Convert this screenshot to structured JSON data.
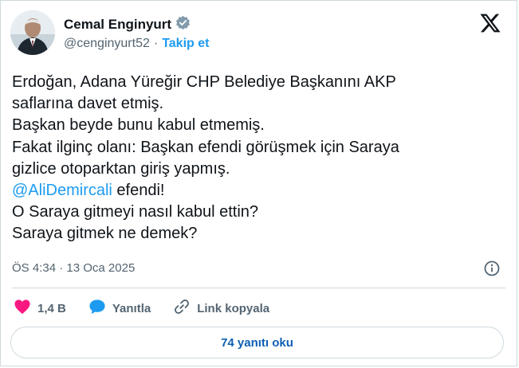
{
  "author": {
    "name": "Cemal Enginyurt",
    "handle": "@cenginyurt52",
    "separator": "·",
    "follow_label": "Takip et"
  },
  "tweet": {
    "line1": "Erdoğan, Adana Yüreğir CHP Belediye Başkanını AKP\nsaflarına davet etmiş.\nBaşkan beyde bunu kabul etmemiş.\nFakat ilginç olanı: Başkan efendi görüşmek için Saraya\ngizlice otoparktan giriş yapmış.\n",
    "mention": "@AliDemircali",
    "line2": " efendi!\nO Saraya gitmeyi nasıl kabul ettin?\nSaraya gitmek ne demek?"
  },
  "meta": {
    "time": "ÖS 4:34",
    "separator": "·",
    "date": "13 Oca 2025"
  },
  "actions": {
    "like_count": "1,4 B",
    "reply_label": "Yanıtla",
    "copy_label": "Link kopyala"
  },
  "replies_button": "74 yanıtı oku",
  "colors": {
    "accent": "#1d9bf0",
    "like": "#f91880",
    "muted": "#536471",
    "border": "#cfd9de"
  },
  "icons": [
    "verified-badge-icon",
    "x-logo-icon",
    "info-icon",
    "heart-icon",
    "reply-bubble-icon",
    "link-icon"
  ]
}
